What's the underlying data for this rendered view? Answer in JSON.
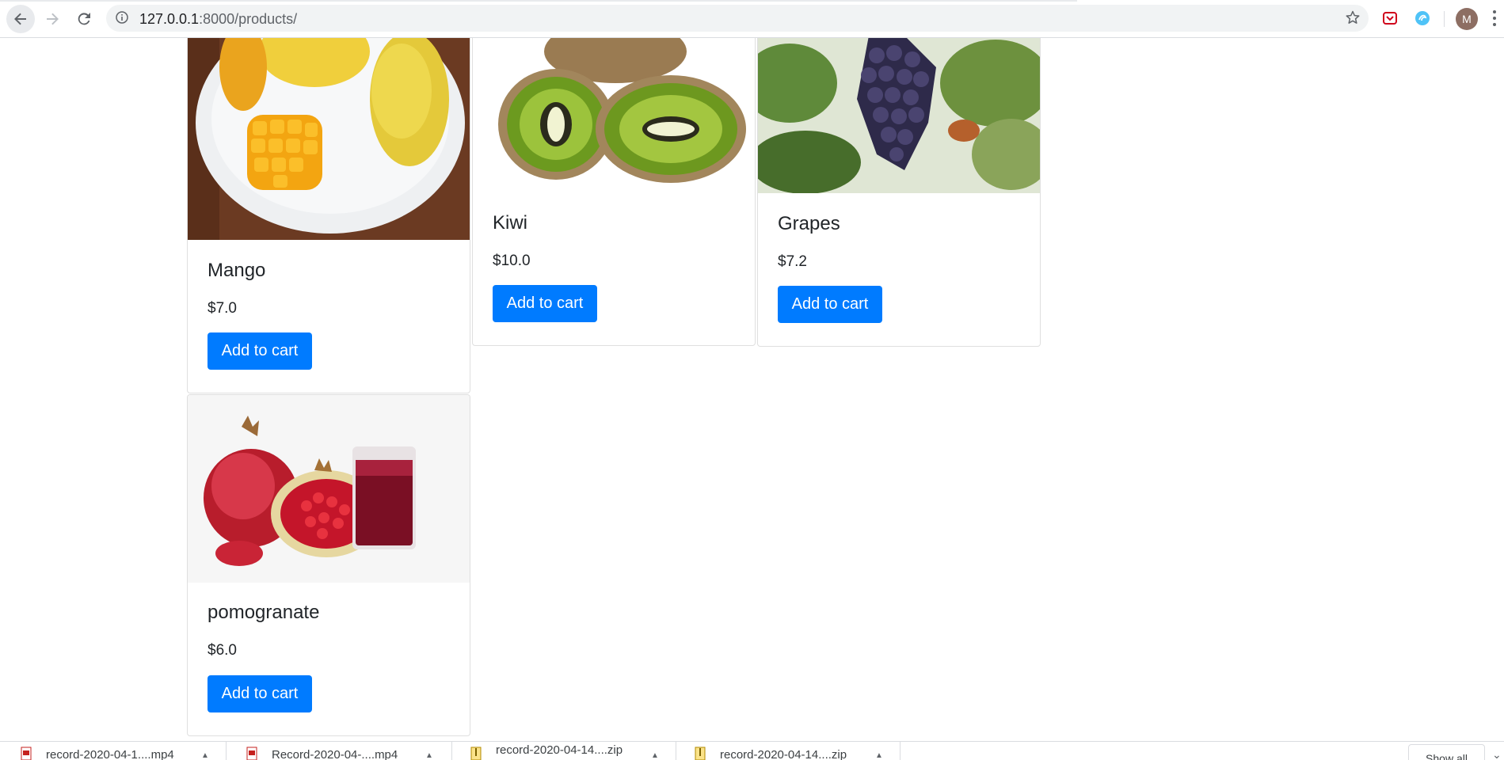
{
  "browser": {
    "url_host": "127.0.0.1",
    "url_path": ":8000/products/",
    "profile_initial": "M"
  },
  "products": [
    {
      "name": "Mango",
      "price": "$7.0",
      "button": "Add to cart"
    },
    {
      "name": "Kiwi",
      "price": "$10.0",
      "button": "Add to cart"
    },
    {
      "name": "Grapes",
      "price": "$7.2",
      "button": "Add to cart"
    },
    {
      "name": "pomogranate",
      "price": "$6.0",
      "button": "Add to cart"
    }
  ],
  "downloads": {
    "items": [
      {
        "label": "record-2020-04-1....mp4",
        "icon": "video-file-icon"
      },
      {
        "label": "Record-2020-04-....mp4",
        "icon": "video-file-icon"
      },
      {
        "label": "record-2020-04-14....zip",
        "icon": "zip-file-icon"
      },
      {
        "label": "record-2020-04-14....zip",
        "icon": "zip-file-icon"
      }
    ],
    "show_all": "Show all"
  }
}
